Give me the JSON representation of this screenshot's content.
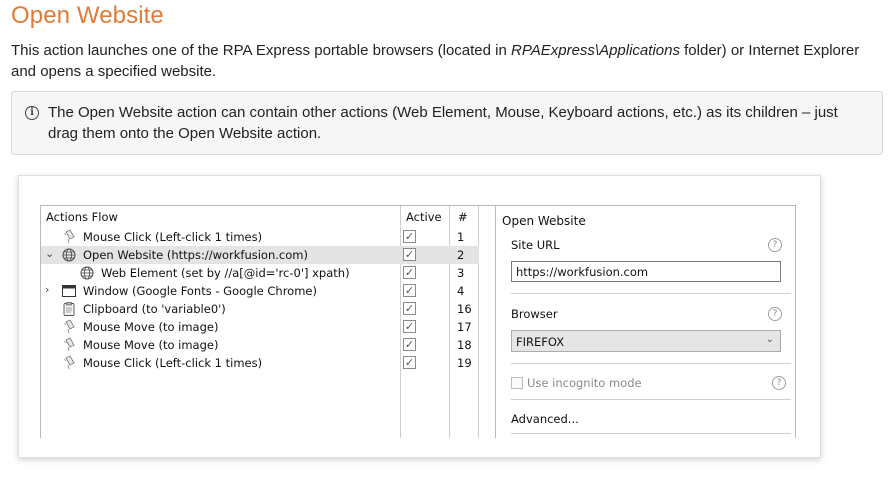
{
  "doc": {
    "title": "Open Website",
    "intro_pre": "This action launches one of the RPA Express portable browsers (located in ",
    "intro_path": "RPAExpress\\Applications",
    "intro_post": " folder) or Internet Explorer and opens a specified website.",
    "note_icon": "info-icon",
    "note_text": "The Open Website action can contain other actions (Web Element, Mouse, Keyboard actions, etc.) as its children – just drag them onto the Open Website action."
  },
  "colors": {
    "title": "#e07b39",
    "selected_row": "#e4e4e4",
    "note_bg": "#f6f6f6"
  },
  "actions_flow": {
    "headers": {
      "name": "Actions Flow",
      "active": "Active",
      "num": "#"
    },
    "rows": [
      {
        "label": "Mouse Click (Left-click 1 times)",
        "num": "1",
        "icon": "mouse-icon",
        "caret": "",
        "indent": 0,
        "selected": false,
        "active": true
      },
      {
        "label": "Open Website (https://workfusion.com)",
        "num": "2",
        "icon": "globe-icon",
        "caret": "⌄",
        "indent": 0,
        "selected": true,
        "active": true
      },
      {
        "label": "Web Element (set by //a[@id='rc-0'] xpath)",
        "num": "3",
        "icon": "globe-icon",
        "caret": "",
        "indent": 1,
        "selected": false,
        "active": true
      },
      {
        "label": "Window (Google Fonts - Google Chrome)",
        "num": "4",
        "icon": "window-icon",
        "caret": "›",
        "indent": 0,
        "selected": false,
        "active": true
      },
      {
        "label": "Clipboard (to 'variable0')",
        "num": "16",
        "icon": "clipboard-icon",
        "caret": "",
        "indent": 0,
        "selected": false,
        "active": true
      },
      {
        "label": "Mouse Move (to image)",
        "num": "17",
        "icon": "mouse-icon",
        "caret": "",
        "indent": 0,
        "selected": false,
        "active": true
      },
      {
        "label": "Mouse Move (to image)",
        "num": "18",
        "icon": "mouse-icon",
        "caret": "",
        "indent": 0,
        "selected": false,
        "active": true
      },
      {
        "label": "Mouse Click (Left-click 1 times)",
        "num": "19",
        "icon": "mouse-icon",
        "caret": "",
        "indent": 0,
        "selected": false,
        "active": true
      }
    ]
  },
  "properties": {
    "title": "Open Website",
    "site_url_label": "Site URL",
    "site_url_value": "https://workfusion.com",
    "browser_label": "Browser",
    "browser_value": "FIREFOX",
    "incognito_label": "Use incognito mode",
    "advanced_label": "Advanced...",
    "help_glyph": "?"
  }
}
